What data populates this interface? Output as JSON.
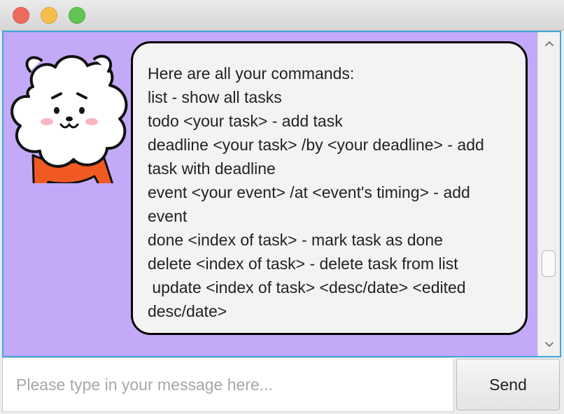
{
  "window": {
    "controls": [
      "close",
      "minimize",
      "zoom"
    ]
  },
  "chat": {
    "background_color": "#c3a9f7",
    "bot_avatar": "rj-bear-avatar",
    "message_lines": [
      "Here are all your commands:",
      "list - show all tasks",
      "todo <your task> - add task",
      "deadline <your task> /by <your deadline> - add",
      "task with deadline",
      "event <your event> /at <event's timing> - add",
      "event",
      "done <index of task> - mark task as done",
      "delete <index of task> - delete task from list",
      " update <index of task> <desc/date> <edited",
      "desc/date>"
    ]
  },
  "scrollbar": {
    "up_icon": "chevron-up-icon",
    "down_icon": "chevron-down-icon",
    "position_fraction": 0.82
  },
  "input": {
    "placeholder": "Please type in your message here...",
    "value": ""
  },
  "send": {
    "label": "Send"
  }
}
